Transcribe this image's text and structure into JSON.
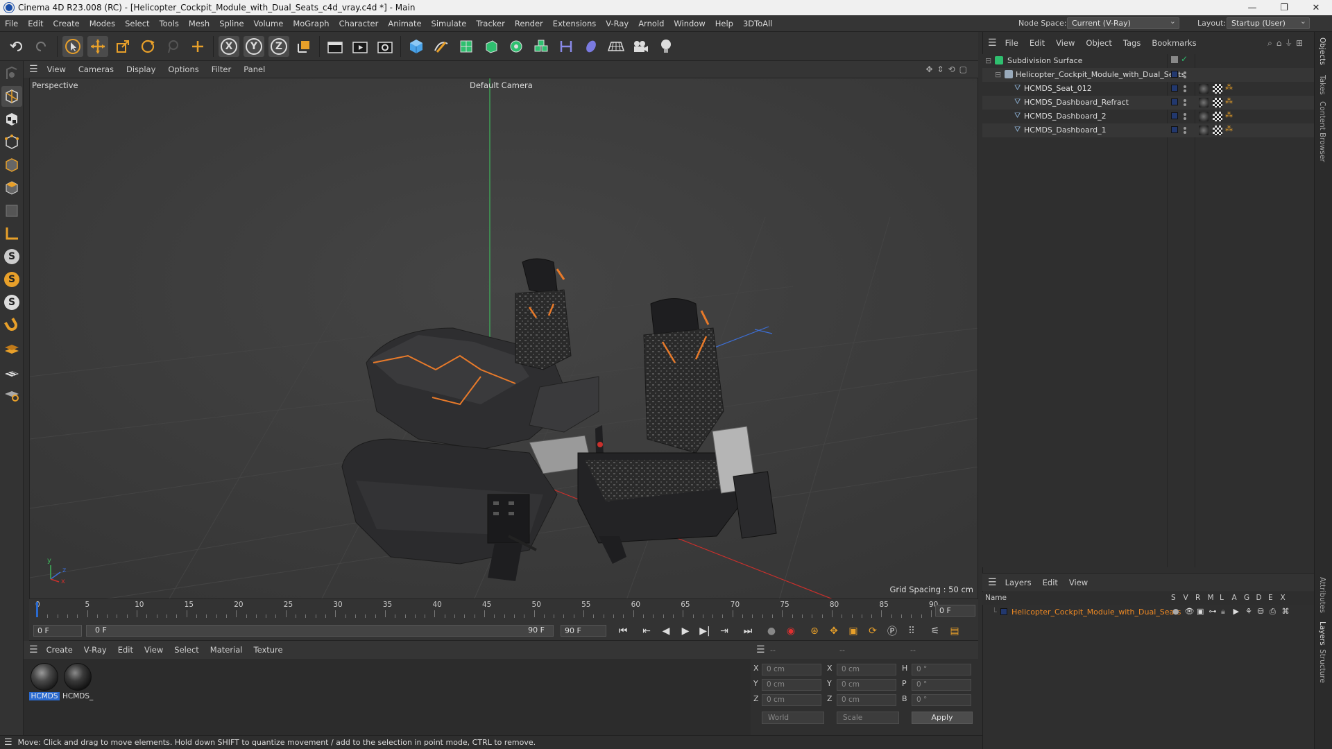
{
  "window": {
    "title": "Cinema 4D R23.008 (RC) - [Helicopter_Cockpit_Module_with_Dual_Seats_c4d_vray.c4d *] - Main",
    "controls": [
      "—",
      "❐",
      "✕"
    ]
  },
  "menubar": {
    "items": [
      "File",
      "Edit",
      "Create",
      "Modes",
      "Select",
      "Tools",
      "Mesh",
      "Spline",
      "Volume",
      "MoGraph",
      "Character",
      "Animate",
      "Simulate",
      "Tracker",
      "Render",
      "Extensions",
      "V-Ray",
      "Arnold",
      "Window",
      "Help",
      "3DToAll"
    ],
    "node_space_label": "Node Space:",
    "node_space_value": "Current (V-Ray)",
    "layout_label": "Layout:",
    "layout_value": "Startup (User)"
  },
  "toolbar": {
    "axis_x": "X",
    "axis_y": "Y",
    "axis_z": "Z"
  },
  "lefttools": {
    "s1": "S",
    "s2": "S",
    "s3": "S"
  },
  "viewport": {
    "menu": [
      "View",
      "Cameras",
      "Display",
      "Options",
      "Filter",
      "Panel"
    ],
    "label": "Perspective",
    "camera": "Default Camera",
    "grid_spacing": "Grid Spacing : 50 cm",
    "axis_y": "y",
    "axis_z": "z",
    "axis_x": "x"
  },
  "timeline": {
    "ticks": [
      "0",
      "5",
      "10",
      "15",
      "20",
      "25",
      "30",
      "35",
      "40",
      "45",
      "50",
      "55",
      "60",
      "65",
      "70",
      "75",
      "80",
      "85",
      "90"
    ],
    "end_field": "0 F"
  },
  "playbar": {
    "current": "0 F",
    "range_start": "0 F",
    "range_end": "90 F",
    "max": "90 F"
  },
  "materials": {
    "menu": [
      "Create",
      "V-Ray",
      "Edit",
      "View",
      "Select",
      "Material",
      "Texture"
    ],
    "items": [
      {
        "label": "HCMDS"
      },
      {
        "label": "HCMDS_"
      }
    ]
  },
  "coordinates": {
    "headers": [
      "--",
      "--",
      "--"
    ],
    "rows": [
      {
        "l1": "X",
        "v1": "0 cm",
        "l2": "X",
        "v2": "0 cm",
        "l3": "H",
        "v3": "0 °"
      },
      {
        "l1": "Y",
        "v1": "0 cm",
        "l2": "Y",
        "v2": "0 cm",
        "l3": "P",
        "v3": "0 °"
      },
      {
        "l1": "Z",
        "v1": "0 cm",
        "l2": "Z",
        "v2": "0 cm",
        "l3": "B",
        "v3": "0 °"
      }
    ],
    "space": "World",
    "mode": "Scale",
    "apply": "Apply"
  },
  "status": "Move: Click and drag to move elements. Hold down SHIFT to quantize movement / add to the selection in point mode, CTRL to remove.",
  "objects": {
    "menu": [
      "File",
      "Edit",
      "View",
      "Object",
      "Tags",
      "Bookmarks"
    ],
    "tree": [
      {
        "name": "Subdivision Surface"
      },
      {
        "name": "Helicopter_Cockpit_Module_with_Dual_Seats"
      },
      {
        "name": "HCMDS_Seat_012"
      },
      {
        "name": "HCMDS_Dashboard_Refract"
      },
      {
        "name": "HCMDS_Dashboard_2"
      },
      {
        "name": "HCMDS_Dashboard_1"
      }
    ]
  },
  "layers": {
    "menu": [
      "Layers",
      "Edit",
      "View"
    ],
    "col_name": "Name",
    "cols": [
      "S",
      "V",
      "R",
      "M",
      "L",
      "A",
      "G",
      "D",
      "E",
      "X"
    ],
    "layer_name": "Helicopter_Cockpit_Module_with_Dual_Seats",
    "layer_color": "#f08a24"
  },
  "side_tabs": [
    "Objects",
    "Takes",
    "Content Browser",
    "Attributes",
    "Layers",
    "Structure"
  ],
  "colors": {
    "accent_orange": "#e87a2a",
    "selection_blue": "#2a6ad0",
    "axis_green": "#3fb55b",
    "axis_red": "#c9302c",
    "axis_blue": "#3d6fd6"
  }
}
